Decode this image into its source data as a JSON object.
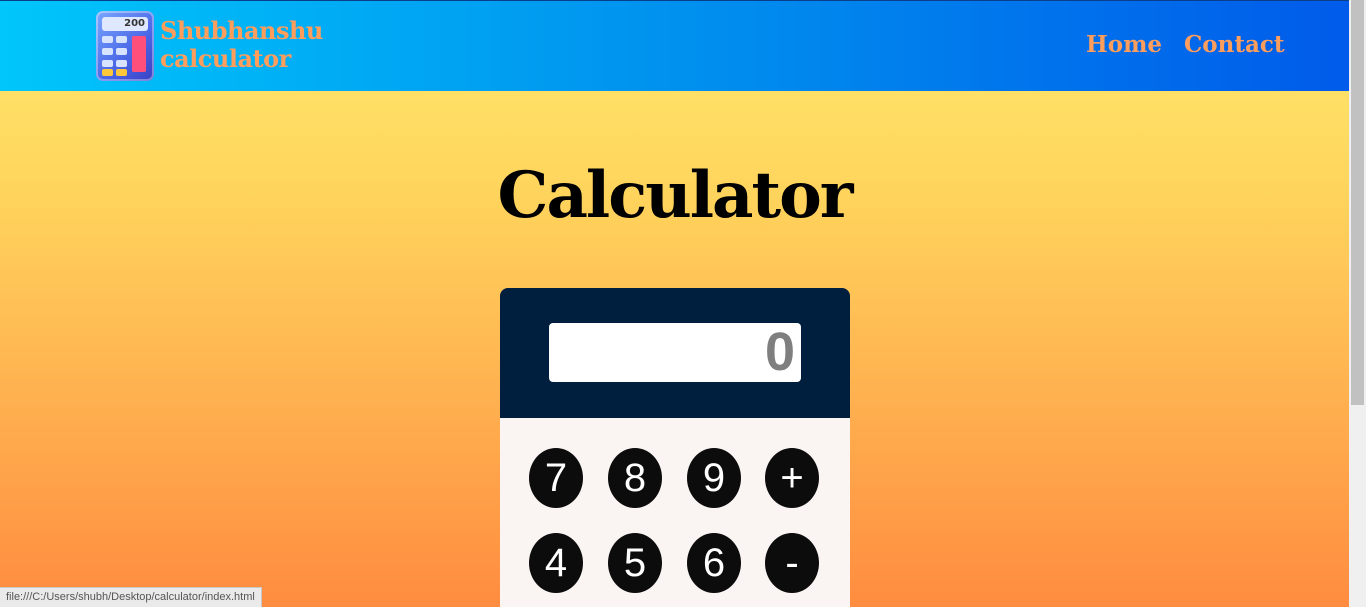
{
  "brand": {
    "line1": "Shubhanshu",
    "line2": "calculator",
    "icon": "calculator-icon",
    "icon_screen_text": "200"
  },
  "nav": {
    "home": "Home",
    "contact": "Contact"
  },
  "page_title": "Calculator",
  "calculator": {
    "display_value": "0",
    "keys": [
      "7",
      "8",
      "9",
      "+",
      "4",
      "5",
      "6",
      "-"
    ]
  },
  "status_bar": {
    "url": "file:///C:/Users/shubh/Desktop/calculator/index.html"
  },
  "colors": {
    "nav_gradient_start": "#00c6fb",
    "nav_gradient_end": "#005bea",
    "brand_text": "#ff9d5c",
    "calc_header": "#001f3f",
    "key_bg": "#0c0c0c",
    "page_gradient_top": "#ffe066",
    "page_gradient_bottom": "#ff8c40"
  }
}
